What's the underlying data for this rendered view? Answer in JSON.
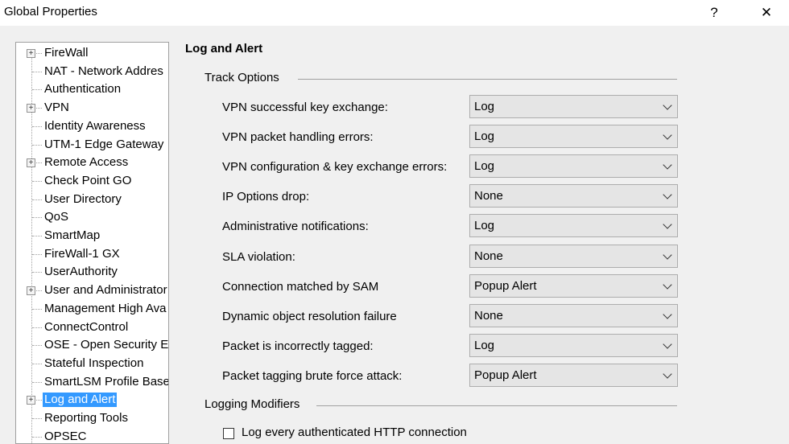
{
  "window": {
    "title": "Global Properties",
    "help": "?",
    "close": "✕"
  },
  "tree": [
    {
      "label": "FireWall",
      "expandable": true
    },
    {
      "label": "NAT - Network Addres",
      "expandable": false
    },
    {
      "label": "Authentication",
      "expandable": false
    },
    {
      "label": "VPN",
      "expandable": true
    },
    {
      "label": "Identity Awareness",
      "expandable": false
    },
    {
      "label": "UTM-1 Edge Gateway",
      "expandable": false
    },
    {
      "label": "Remote Access",
      "expandable": true
    },
    {
      "label": "Check Point GO",
      "expandable": false
    },
    {
      "label": "User Directory",
      "expandable": false
    },
    {
      "label": "QoS",
      "expandable": false
    },
    {
      "label": "SmartMap",
      "expandable": false
    },
    {
      "label": "FireWall-1 GX",
      "expandable": false
    },
    {
      "label": "UserAuthority",
      "expandable": false
    },
    {
      "label": "User and Administrator",
      "expandable": true
    },
    {
      "label": "Management High Ava",
      "expandable": false
    },
    {
      "label": "ConnectControl",
      "expandable": false
    },
    {
      "label": "OSE - Open Security E",
      "expandable": false
    },
    {
      "label": "Stateful Inspection",
      "expandable": false
    },
    {
      "label": "SmartLSM Profile Base",
      "expandable": false
    },
    {
      "label": "Log and Alert",
      "expandable": true,
      "selected": true
    },
    {
      "label": "Reporting Tools",
      "expandable": false
    },
    {
      "label": "OPSEC",
      "expandable": false
    }
  ],
  "main": {
    "heading": "Log and Alert",
    "track_options": "Track Options",
    "rows": [
      {
        "label": "VPN successful key exchange:",
        "value": "Log"
      },
      {
        "label": "VPN packet handling errors:",
        "value": "Log"
      },
      {
        "label": "VPN configuration & key exchange errors:",
        "value": "Log"
      },
      {
        "label": "IP Options drop:",
        "value": "None"
      },
      {
        "label": "Administrative notifications:",
        "value": "Log"
      },
      {
        "label": "SLA violation:",
        "value": "None"
      },
      {
        "label": "Connection matched by SAM",
        "value": "Popup Alert"
      },
      {
        "label": "Dynamic object resolution failure",
        "value": "None"
      },
      {
        "label": "Packet is incorrectly tagged:",
        "value": "Log"
      },
      {
        "label": "Packet tagging brute force attack:",
        "value": "Popup Alert"
      }
    ],
    "logging_modifiers": "Logging Modifiers",
    "checkbox_label": "Log every authenticated HTTP connection",
    "checkbox_checked": false
  },
  "colors": {
    "selection": "#3399ff"
  }
}
